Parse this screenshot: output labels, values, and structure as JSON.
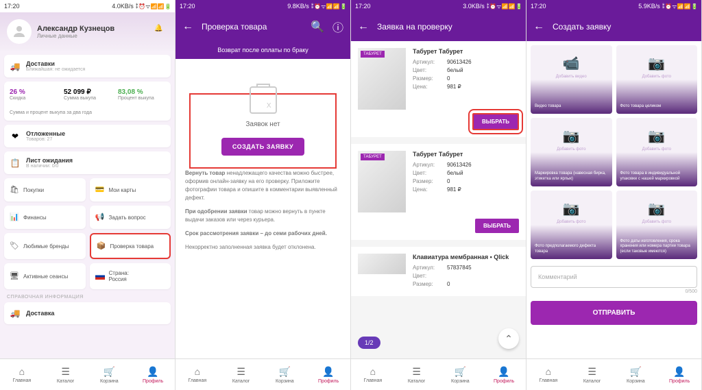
{
  "status": {
    "time": "17:20",
    "speeds": [
      "4.0KB/s",
      "9.8KB/s",
      "3.0KB/s",
      "5.9KB/s"
    ],
    "icons": "⁑ ⏰ ᯤ 📶 📶 🔋"
  },
  "s1": {
    "user_name": "Александр Кузнецов",
    "user_sub": "Личные данные",
    "delivery_title": "Доставки",
    "delivery_sub": "Ближайшая: не ожидается",
    "stats": [
      {
        "val": "26 %",
        "label": "Скидка"
      },
      {
        "val": "52 099 ₽",
        "label": "Сумма выкупа"
      },
      {
        "val": "83,08 %",
        "label": "Процент выкупа"
      }
    ],
    "stats_note": "Сумма и процент выкупа за два года",
    "deferred_title": "Отложенные",
    "deferred_sub": "Товаров: 27",
    "waitlist_title": "Лист ожидания",
    "waitlist_sub": "В наличии: 0/0",
    "grid": [
      {
        "icon": "🛍",
        "label": "Покупки"
      },
      {
        "icon": "💳",
        "label": "Мои карты"
      },
      {
        "icon": "📊",
        "label": "Финансы"
      },
      {
        "icon": "📢",
        "label": "Задать вопрос"
      },
      {
        "icon": "🏷",
        "label": "Любимые бренды"
      },
      {
        "icon": "📦",
        "label": "Проверка товара"
      },
      {
        "icon": "🖥",
        "label": "Активные сеансы"
      },
      {
        "icon": "",
        "label": "Страна:\nРоссия"
      }
    ],
    "ref_section": "СПРАВОЧНАЯ ИНФОРМАЦИЯ",
    "ref_delivery": "Доставка"
  },
  "s2": {
    "title": "Проверка товара",
    "tab": "Возврат после оплаты по браку",
    "empty": "Заявок нет",
    "create_btn": "СОЗДАТЬ ЗАЯВКУ",
    "info1_bold": "Вернуть товар",
    "info1": " ненадлежащего качества можно быстрее, оформив онлайн-заявку на его проверку. Приложите фотографии товара и опишите в комментарии выявленный дефект.",
    "info2_bold": "При одобрении заявки",
    "info2": " товар можно вернуть в пункте выдачи заказов или через курьера.",
    "info3": "Срок рассмотрения заявки – до семи рабочих дней.",
    "info4": "Некорректно заполненная заявка будет отклонена."
  },
  "s3": {
    "title": "Заявка на проверку",
    "products": [
      {
        "badge": "ТАБУРЕТ",
        "name": "Табурет Табурет",
        "sku": "90613426",
        "color": "белый",
        "size": "0",
        "price": "981 ₽"
      },
      {
        "badge": "ТАБУРЕТ",
        "name": "Табурет Табурет",
        "sku": "90613426",
        "color": "белый",
        "size": "0",
        "price": "981 ₽"
      },
      {
        "badge": "",
        "name": "Клавиатура мембранная • Qlick",
        "sku": "57837845",
        "color": "",
        "size": "0",
        "price": ""
      }
    ],
    "keys": {
      "sku": "Артикул:",
      "color": "Цвет:",
      "size": "Размер:",
      "price": "Цена:"
    },
    "select_btn": "ВЫБРАТЬ",
    "pager": "1/2"
  },
  "s4": {
    "title": "Создать заявку",
    "tiles": [
      {
        "icon": "📹",
        "label": "Добавить видео",
        "desc": "Видео товара"
      },
      {
        "icon": "📷",
        "label": "Добавить фото",
        "desc": "Фото товара целиком"
      },
      {
        "icon": "📷",
        "label": "Добавить фото",
        "desc": "Маркировка товара (навесная бирка, этикетка или ярлык)"
      },
      {
        "icon": "📷",
        "label": "Добавить фото",
        "desc": "Фото товара в индивидуальной упаковке с нашей маркировкой"
      },
      {
        "icon": "📷",
        "label": "Добавить фото",
        "desc": "Фото предполагаемого дефекта товара"
      },
      {
        "icon": "📷",
        "label": "Добавить фото",
        "desc": "Фото даты изготовления, срока хранения или номера партии товара (если таковые имеются)"
      }
    ],
    "comment_placeholder": "Комментарий",
    "char_count": "0/500",
    "submit": "ОТПРАВИТЬ"
  },
  "nav": {
    "items": [
      {
        "icon": "⌂",
        "label": "Главная"
      },
      {
        "icon": "☰",
        "label": "Каталог"
      },
      {
        "icon": "🛒",
        "label": "Корзина"
      },
      {
        "icon": "👤",
        "label": "Профиль"
      }
    ]
  }
}
